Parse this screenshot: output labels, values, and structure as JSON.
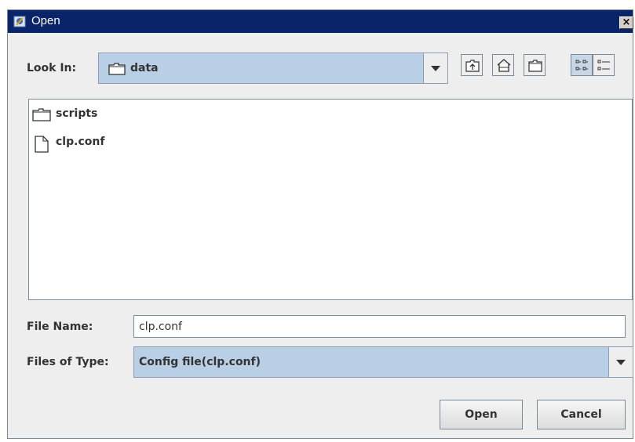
{
  "window": {
    "title": "Open",
    "close_label": "×"
  },
  "look_in": {
    "label": "Look In:",
    "value": "data"
  },
  "toolbar": [
    {
      "name": "up-one-level-button",
      "icon": "up-folder-icon"
    },
    {
      "name": "home-button",
      "icon": "home-icon"
    },
    {
      "name": "new-folder-button",
      "icon": "new-folder-icon"
    },
    {
      "name": "list-view-button",
      "icon": "list-view-icon"
    },
    {
      "name": "details-view-button",
      "icon": "details-view-icon"
    }
  ],
  "files": [
    {
      "name": "scripts",
      "kind": "folder"
    },
    {
      "name": "clp.conf",
      "kind": "file"
    }
  ],
  "file_name": {
    "label": "File Name:",
    "value": "clp.conf"
  },
  "file_type": {
    "label": "Files of Type:",
    "value": "Config file(clp.conf)"
  },
  "buttons": {
    "open": "Open",
    "cancel": "Cancel"
  },
  "colors": {
    "titlebar": "#0a246a",
    "selection": "#b8cfe5",
    "dialog_bg": "#eeeeee"
  }
}
